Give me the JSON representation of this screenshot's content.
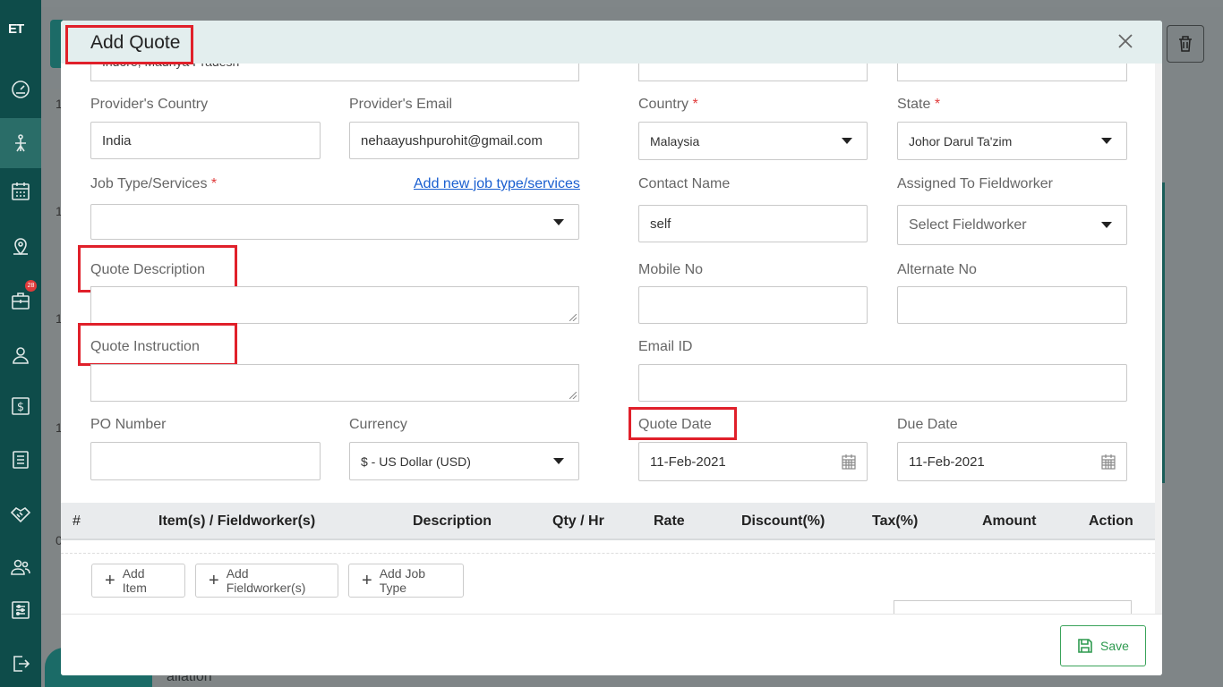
{
  "sidebar": {
    "logo": "ET",
    "badge_count": "28",
    "items": [
      "dashboard-icon",
      "fieldwork-icon",
      "calendar-icon",
      "map-pin-icon",
      "briefcase-icon",
      "user-icon",
      "invoice-icon",
      "list-icon",
      "handshake-icon",
      "users-icon",
      "settings-sliders-icon",
      "logout-icon"
    ]
  },
  "background": {
    "bottom_text": "allation",
    "left_num_1": "1",
    "left_num_2": "1",
    "left_num_3": "1",
    "left_num_4": "1",
    "left_num_5": "0"
  },
  "modal": {
    "title": "Add Quote",
    "cut_text": "Indore, Madhya Pradesh",
    "left": {
      "providers_country_label": "Provider's Country",
      "providers_country_value": "India",
      "providers_email_label": "Provider's Email",
      "providers_email_value": "nehaayushpurohit@gmail.com",
      "job_type_label": "Job Type/Services",
      "job_type_value": "",
      "add_job_type_link": "Add new job type/services",
      "quote_description_label": "Quote Description",
      "quote_instruction_label": "Quote Instruction",
      "po_number_label": "PO Number",
      "po_number_value": "",
      "currency_label": "Currency",
      "currency_value": "$ - US Dollar (USD)"
    },
    "right": {
      "country_label": "Country",
      "country_value": "Malaysia",
      "state_label": "State",
      "state_value": "Johor Darul Ta'zim",
      "contact_name_label": "Contact Name",
      "contact_name_value": "self",
      "assigned_label": "Assigned To Fieldworker",
      "assigned_placeholder": "Select Fieldworker",
      "mobile_label": "Mobile No",
      "alternate_label": "Alternate No",
      "email_label": "Email ID",
      "quote_date_label": "Quote Date",
      "quote_date_value": "11-Feb-2021",
      "due_date_label": "Due Date",
      "due_date_value": "11-Feb-2021"
    },
    "required_mark": "*",
    "table": {
      "headers": [
        "#",
        "Item(s) / Fieldworker(s)",
        "Description",
        "Qty / Hr",
        "Rate",
        "Discount(%)",
        "Tax(%)",
        "Amount",
        "Action"
      ]
    },
    "buttons": {
      "add_item": "Add Item",
      "add_fieldworker": "Add Fieldworker(s)",
      "add_job_type": "Add Job Type",
      "plus": "+",
      "save": "Save"
    }
  }
}
